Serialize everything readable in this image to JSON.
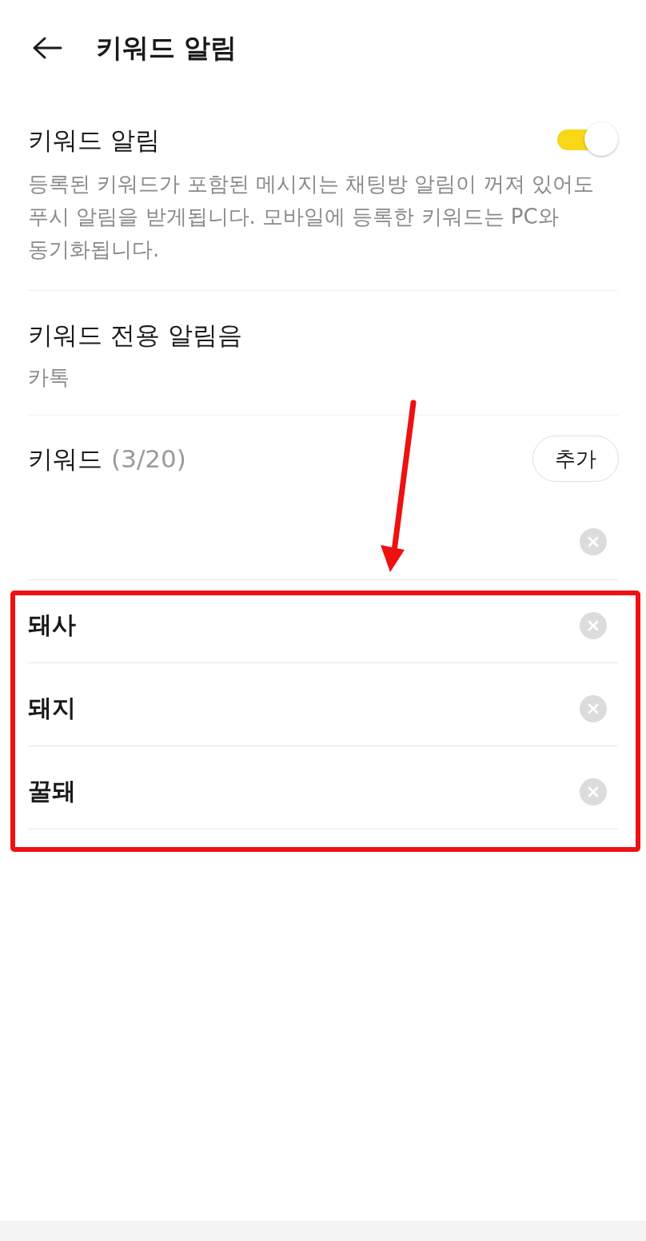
{
  "header": {
    "title": "키워드 알림"
  },
  "notification": {
    "label": "키워드 알림",
    "on": true,
    "description": "등록된 키워드가 포함된 메시지는 채팅방 알림이 꺼져 있어도 푸시 알림을 받게됩니다. 모바일에 등록한 키워드는 PC와 동기화됩니다."
  },
  "sound": {
    "label": "키워드 전용 알림음",
    "value": "카톡"
  },
  "keywords": {
    "label": "키워드",
    "count": "(3/20)",
    "add_button": "추가",
    "items": [
      {
        "kind": "blank"
      },
      {
        "kind": "keyword",
        "text": "돼사"
      },
      {
        "kind": "keyword",
        "text": "돼지"
      },
      {
        "kind": "keyword",
        "text": "꿀돼"
      }
    ]
  },
  "annotation": {
    "arrow": true,
    "highlight_box": true
  }
}
